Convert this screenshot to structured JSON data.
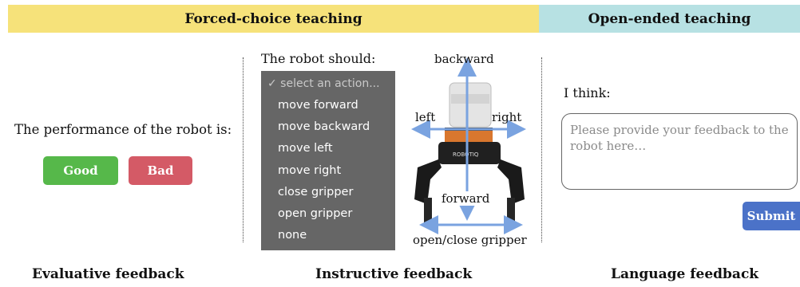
{
  "header": {
    "forced_choice": "Forced-choice teaching",
    "open_ended": "Open-ended teaching"
  },
  "evaluative": {
    "prompt": "The performance of the robot is:",
    "good_label": "Good",
    "bad_label": "Bad",
    "caption": "Evaluative feedback"
  },
  "instructive": {
    "prompt": "The robot should:",
    "placeholder": "✓ select an action...",
    "actions": [
      "move forward",
      "move backward",
      "move left",
      "move right",
      "close gripper",
      "open gripper",
      "none"
    ],
    "directions": {
      "backward": "backward",
      "left": "left",
      "right": "right",
      "forward": "forward",
      "gripper": "open/close gripper"
    },
    "caption": "Instructive feedback"
  },
  "language": {
    "prompt": "I think:",
    "placeholder": "Please provide your feedback to the robot here…",
    "submit_label": "Submit",
    "caption": "Language feedback"
  },
  "colors": {
    "forced_banner": "#f6e27a",
    "open_banner": "#b7e1e3",
    "good": "#56b84a",
    "bad": "#d45a66",
    "submit": "#4b72c8",
    "arrow": "#7aa3e0"
  }
}
